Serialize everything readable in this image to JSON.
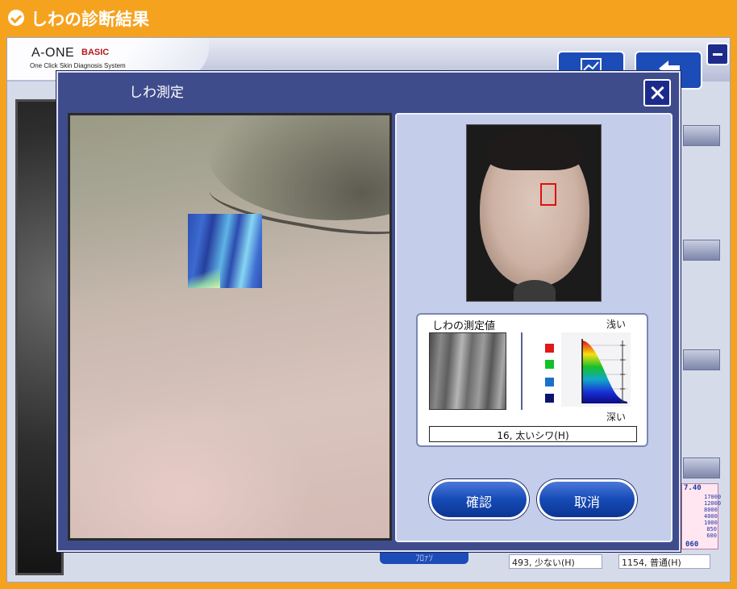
{
  "header": {
    "title": "しわの診断結果"
  },
  "app": {
    "logo": {
      "main": "A-ONE",
      "edition": "BASIC",
      "subtitle": "One Click Skin Diagnosis System"
    },
    "graph": {
      "top_value": "7.40",
      "ticks": [
        "17000",
        "12000",
        "8000",
        "4000",
        "1000",
        "850",
        "600",
        "500",
        "100"
      ],
      "bottom_value": "060"
    },
    "field_left": "493, 少ない(H)",
    "field_right": "1154, 普通(H)",
    "hidden_button": "ﾌﾛｧｿ"
  },
  "modal": {
    "title": "しわ測定",
    "measurement": {
      "label": "しわの測定値",
      "shallow": "浅い",
      "deep": "深い",
      "result": "16, 太いシワ(H)",
      "legend_colors": [
        "#e01818",
        "#13c02a",
        "#1a71c8",
        "#0a1470"
      ]
    },
    "buttons": {
      "confirm": "確認",
      "cancel": "取消"
    }
  },
  "icons": {
    "header": "check-circle-icon",
    "close": "close-icon",
    "minimize": "minimize-icon",
    "chart": "chart-icon",
    "back": "back-arrow-icon"
  }
}
